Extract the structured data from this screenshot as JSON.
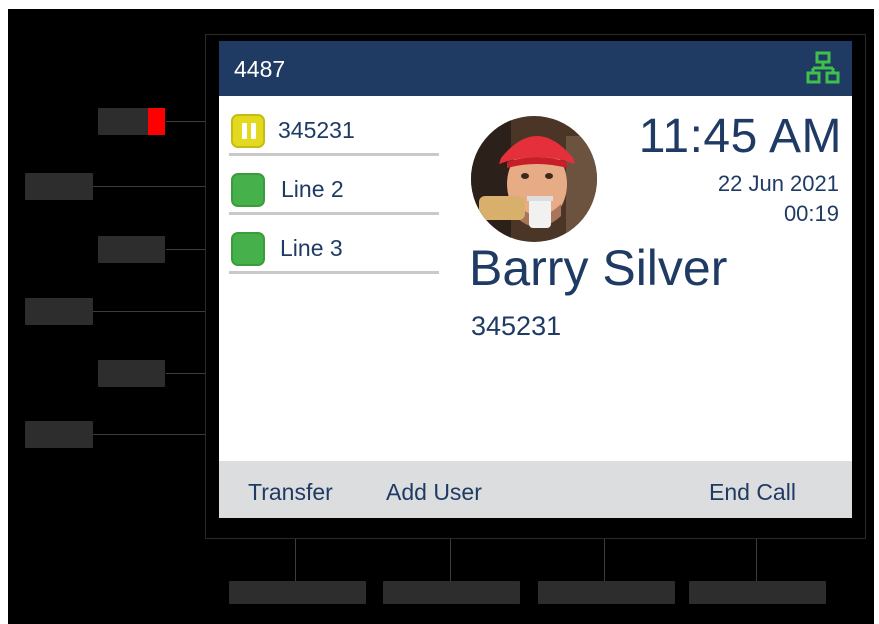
{
  "header": {
    "extension": "4487",
    "network_icon": "network-icon"
  },
  "lines": [
    {
      "label": "345231",
      "state": "hold",
      "icon": "pause-icon"
    },
    {
      "label": "Line 2",
      "state": "idle",
      "icon": "line-status-icon"
    },
    {
      "label": "Line 3",
      "state": "idle",
      "icon": "line-status-icon"
    }
  ],
  "clock": {
    "time": "11:45 AM",
    "date": "22 Jun 2021",
    "duration": "00:19"
  },
  "caller": {
    "name": "Barry Silver",
    "number": "345231",
    "avatar_icon": "caller-avatar"
  },
  "softkeys": {
    "transfer": "Transfer",
    "add_user": "Add User",
    "end_call": "End Call"
  },
  "colors": {
    "header_bg": "#1f3b64",
    "text": "#1f3b64",
    "line_idle": "#46b04a",
    "line_hold": "#e3d91f",
    "message_led": "#ff0000",
    "softkey_bar": "#dcdddf"
  }
}
